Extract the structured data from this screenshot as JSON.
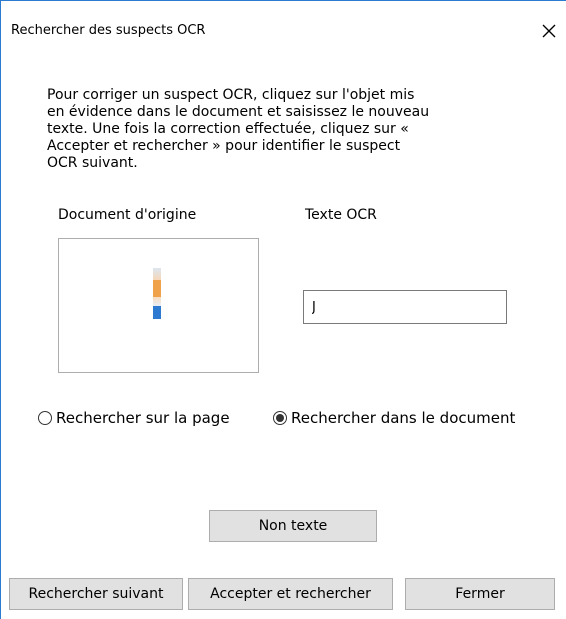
{
  "window": {
    "title": "Rechercher des suspects OCR",
    "close_glyph": "✕"
  },
  "instructions": "Pour corriger un suspect OCR, cliquez sur l'objet mis\nen évidence dans le document et saisissez le nouveau\ntexte. Une fois la correction effectuée, cliquez sur «\nAccepter et rechercher » pour identifier le suspect\nOCR suivant.",
  "labels": {
    "document": "Document d'origine",
    "ocr_text": "Texte OCR"
  },
  "ocr_field": {
    "value": "J"
  },
  "scope": {
    "page_label": "Rechercher sur la page",
    "document_label": "Rechercher dans le document",
    "selected": "document"
  },
  "buttons": {
    "non_text": "Non texte",
    "search_next": "Rechercher suivant",
    "accept_search": "Accepter et rechercher",
    "close": "Fermer"
  },
  "colors": {
    "window_border": "#2b7bd1",
    "button_face": "#e1e1e1",
    "button_border": "#adadad",
    "preview_orange": "#f0a24a",
    "preview_blue": "#2e7ad1"
  }
}
